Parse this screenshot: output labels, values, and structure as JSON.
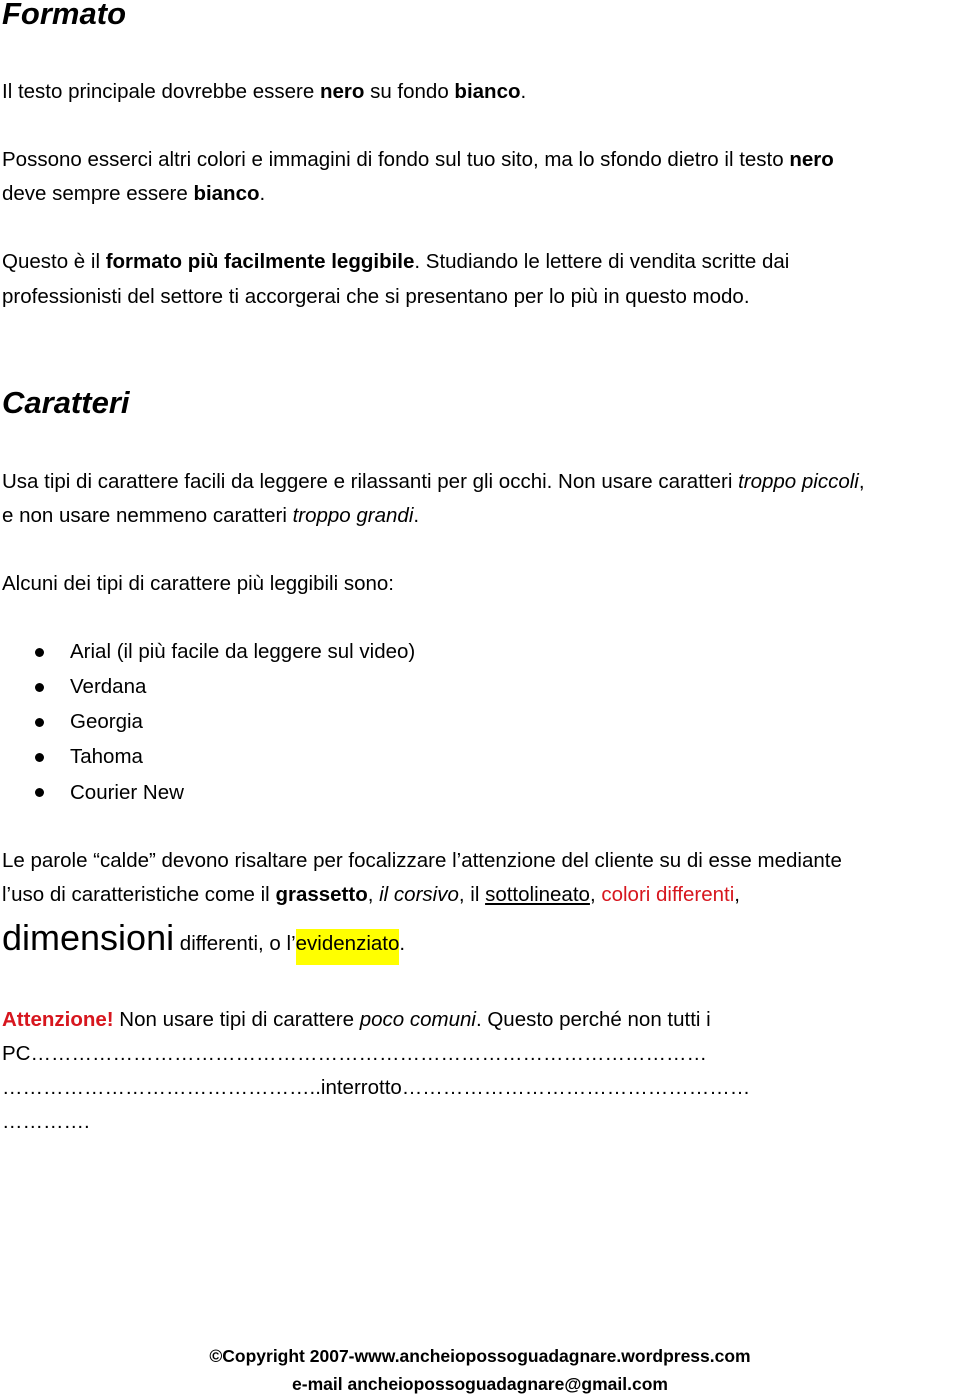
{
  "section_formato": {
    "title": "Formato",
    "p1": {
      "a": "Il testo principale dovrebbe essere ",
      "b_bold": "nero",
      "c": " su fondo ",
      "d_bold": "bianco",
      "e": "."
    },
    "p2": {
      "line1_a": "Possono esserci altri colori e immagini di fondo sul tuo sito, ma lo sfondo dietro il testo ",
      "line1_bold": "nero",
      "line2_a": "deve sempre essere ",
      "line2_bold": "bianco",
      "line2_end": "."
    },
    "p3": {
      "line1_a": "Questo è il ",
      "line1_bold": "formato più facilmente leggibile",
      "line1_c": ". Studiando le lettere di vendita scritte dai",
      "line2": "professionisti del settore ti accorgerai che si presentano per lo più in questo modo."
    }
  },
  "section_caratteri": {
    "title": "Caratteri",
    "p1": {
      "line1_a": "Usa tipi di carattere facili da leggere e rilassanti per gli occhi. Non usare caratteri ",
      "line1_italic": "troppo piccoli",
      "line1_end": ",",
      "line2_a": "e non usare nemmeno caratteri ",
      "line2_italic": "troppo grandi",
      "line2_end": "."
    },
    "p2": "Alcuni dei tipi di carattere più leggibili sono:",
    "font_list": [
      "Arial (il più facile da leggere sul video)",
      "Verdana",
      "Georgia",
      "Tahoma",
      "Courier New"
    ],
    "p3": {
      "line1": "Le parole “calde” devono risaltare per focalizzare l’attenzione del cliente su di esse mediante",
      "line2_a": "l’uso di caratteristiche come il ",
      "line2_bold": "grassetto",
      "line2_b": ", ",
      "line2_italic": "il corsivo",
      "line2_c": ", il ",
      "line2_underline": "sottolineato",
      "line2_d": ", ",
      "line2_red": "colori differenti",
      "line2_e": ",",
      "line3_big": "dimensioni",
      "line3_a": " differenti, o l’",
      "line3_highlight": "evidenziato",
      "line3_end": "."
    },
    "p4": {
      "warning": "Attenzione!",
      "line1_a": " Non usare tipi di carattere ",
      "line1_italic": "poco comuni",
      "line1_b": ". Questo perché non tutti i",
      "line2": "PC………………………………………………………………………………………",
      "line3": "………………………………………..interrotto……………………………………………",
      "line4": "…………."
    }
  },
  "footer": {
    "copyright": "©Copyright 2007-www.ancheiopossoguadagnare.wordpress.com",
    "email": "e-mail ancheiopossoguadagnare@gmail.com"
  },
  "colors": {
    "text": "#000000",
    "accent_red": "#d7161e",
    "highlight": "#ffff00"
  }
}
